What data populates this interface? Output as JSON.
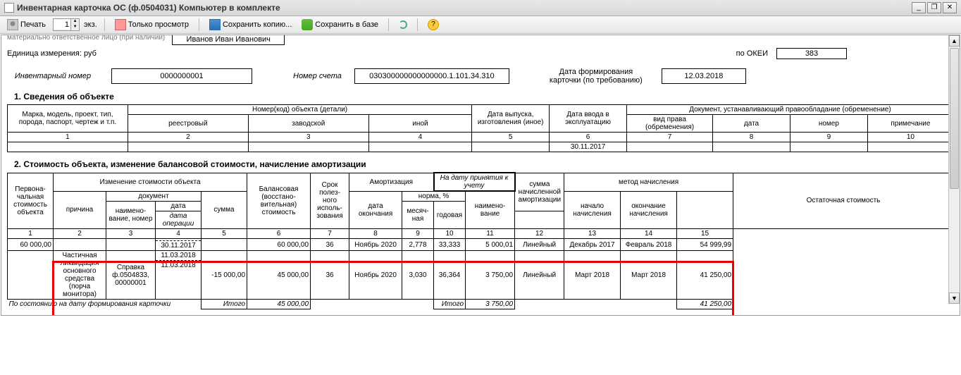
{
  "window": {
    "title": "Инвентарная карточка ОС (ф.0504031) Компьютер в комплекте",
    "min": "_",
    "max": "❐",
    "close": "✕"
  },
  "toolbar": {
    "print": "Печать",
    "copies_value": "1",
    "copies_suffix": "экз.",
    "view_only": "Только просмотр",
    "save_copy": "Сохранить копию...",
    "save_db": "Сохранить в базе",
    "help_glyph": "?"
  },
  "header": {
    "clipped": "материально ответственное лицо (при наличии)",
    "responsible_name": "Иванов Иван Иванович",
    "unit_label": "Единица измерения: руб",
    "okei_label": "по ОКЕИ",
    "okei_value": "383",
    "inv_label": "Инвентарный номер",
    "inv_value": "0000000001",
    "acct_label": "Номер счета",
    "acct_value": "030300000000000000.1.101.34.310",
    "date_label": "Дата формирования карточки (по требованию)",
    "date_value": "12.03.2018"
  },
  "section1": {
    "title": "1. Сведения об объекте",
    "h_mark": "Марка, модель, проект, тип, порода, паспорт, чертеж и т.п.",
    "h_numcode": "Номер(код) объекта (детали)",
    "h_reestr": "реестровый",
    "h_zavod": "заводской",
    "h_inoi": "иной",
    "h_release": "Дата выпуска, изготовления (иное)",
    "h_commiss": "Дата ввода в эксплуатацию",
    "h_doc": "Документ, устанавливающий правообладание (обременение)",
    "h_vid": "вид права (обременения)",
    "h_data": "дата",
    "h_nomer": "номер",
    "h_prim": "примечание",
    "n1": "1",
    "n2": "2",
    "n3": "3",
    "n4": "4",
    "n5": "5",
    "n6": "6",
    "n7": "7",
    "n8": "8",
    "n9": "9",
    "n10": "10",
    "row_date": "30.11.2017"
  },
  "section2": {
    "title": "2. Стоимость объекта, изменение балансовой стоимости, начисление амортизации",
    "h_initcost": "Первона- чальная стоимость объекта",
    "h_change": "Изменение стоимости объекта",
    "h_reason": "причина",
    "h_docgrp": "документ",
    "h_docname": "наимено- вание, номер",
    "h_docdate": "дата",
    "h_docdate_italic": "дата операции",
    "h_sum": "сумма",
    "h_balance": "Балансовая (восстано- вительная) стоимость",
    "h_useful": "Срок полез- ного исполь- зования",
    "h_amort": "Амортизация",
    "h_amort_date_note": "На дату принятия к учету",
    "h_enddate": "дата окончания",
    "h_norm": "норма, %",
    "h_norm_m": "месяч- ная",
    "h_norm_y": "годовая",
    "h_accrued": "сумма начисленной амортизации",
    "h_method": "метод начисления",
    "h_methname": "наимено- вание",
    "h_methstart": "начало начисления",
    "h_methend": "окончание начисления",
    "h_residual": "Остаточная стоимость",
    "n1": "1",
    "n2": "2",
    "n3": "3",
    "n4": "4",
    "n5": "5",
    "n6": "6",
    "n7": "7",
    "n8": "8",
    "n9": "9",
    "n10": "10",
    "n11": "11",
    "n12": "12",
    "n13": "13",
    "n14": "14",
    "n15": "15",
    "row1": {
      "c1": "60 000,00",
      "c4a": "30.11.2017",
      "c6": "60 000,00",
      "c7": "36",
      "c8": "Ноябрь 2020",
      "c9": "2,778",
      "c10": "33,333",
      "c11": "5 000,01",
      "c12": "Линейный",
      "c13": "Декабрь 2017",
      "c14": "Февраль 2018",
      "c15": "54 999,99"
    },
    "row2": {
      "c2": "Частичная ликвидация основного средства (порча монитора)",
      "c3": "Справка ф.0504833, 00000001",
      "c4": "11.03.2018",
      "c4a": "11.03.2018",
      "c5": "-15 000,00",
      "c6": "45 000,00",
      "c7": "36",
      "c8": "Ноябрь 2020",
      "c9": "3,030",
      "c10": "36,364",
      "c11": "3 750,00",
      "c12": "Линейный",
      "c13": "Март 2018",
      "c14": "Март 2018",
      "c15": "41 250,00"
    },
    "footer": {
      "label": "По состоянию на дату формирования карточки",
      "itogo": "Итого",
      "balance": "45 000,00",
      "amort": "3 750,00",
      "residual": "41 250,00"
    }
  }
}
